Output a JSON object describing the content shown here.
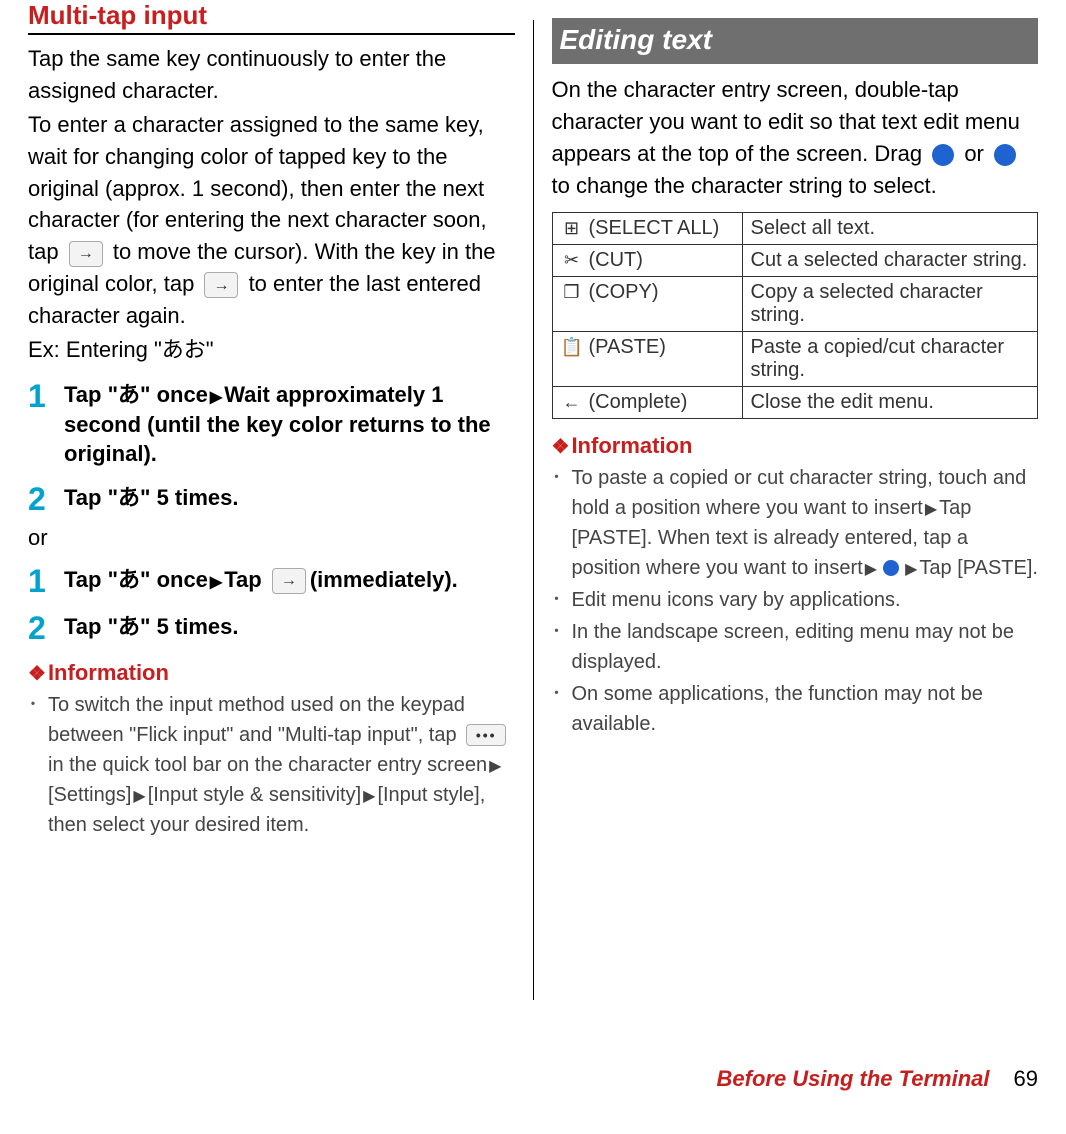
{
  "left": {
    "heading": "Multi-tap input",
    "para1": "Tap the same key continuously to enter the assigned character.",
    "para2a": "To enter a character assigned to the same key, wait for changing color of tapped key to the original (approx. 1 second), then enter the next character (for entering the next character soon, tap ",
    "para2b": " to move the cursor). With the key in the original color, tap ",
    "para2c": " to enter the last entered character again.",
    "ex": "Ex: Entering \"あお\"",
    "step1a": "Tap \"あ\" once",
    "step1b": "Wait approximately 1 second (until the key color returns to the original).",
    "step2": "Tap \"あ\" 5 times.",
    "or": "or",
    "stepB1a": "Tap \"あ\" once",
    "stepB1b": "Tap",
    "stepB1c": "(immediately).",
    "stepB2": "Tap \"あ\" 5 times.",
    "infoHeading": "Information",
    "info1a": "To switch the input method used on the keypad between \"Flick input\" and \"Multi-tap input\", tap ",
    "info1b": " in the quick tool bar on the character entry screen",
    "info1c": "[Settings]",
    "info1d": "[Input style & sensitivity]",
    "info1e": "[Input style], then select your desired item."
  },
  "right": {
    "barTitle": "Editing text",
    "para1a": "On the character entry screen, double-tap character you want to edit so that text edit menu appears at the top of the screen. Drag ",
    "para1b": " or ",
    "para1c": " to change the character string to select.",
    "rows": [
      {
        "iconText": "⊞",
        "label": "(SELECT ALL)",
        "desc": "Select all text."
      },
      {
        "iconText": "✂",
        "label": "(CUT)",
        "desc": "Cut a selected character string."
      },
      {
        "iconText": "❐",
        "label": "(COPY)",
        "desc": "Copy a selected character string."
      },
      {
        "iconText": "📋",
        "label": "(PASTE)",
        "desc": "Paste a copied/cut character string."
      },
      {
        "iconText": "←",
        "label": "(Complete)",
        "desc": "Close the edit menu."
      }
    ],
    "infoHeading": "Information",
    "info1a": "To paste a copied or cut character string, touch and hold a position where you want to insert",
    "info1b": "Tap [PASTE]. When text is already entered, tap a position where you want to insert",
    "info1c": "Tap [PASTE].",
    "info2": "Edit menu icons vary by applications.",
    "info3": "In the landscape screen, editing menu may not be displayed.",
    "info4": "On some applications, the function may not be available."
  },
  "footer": {
    "section": "Before Using the Terminal",
    "page": "69"
  }
}
